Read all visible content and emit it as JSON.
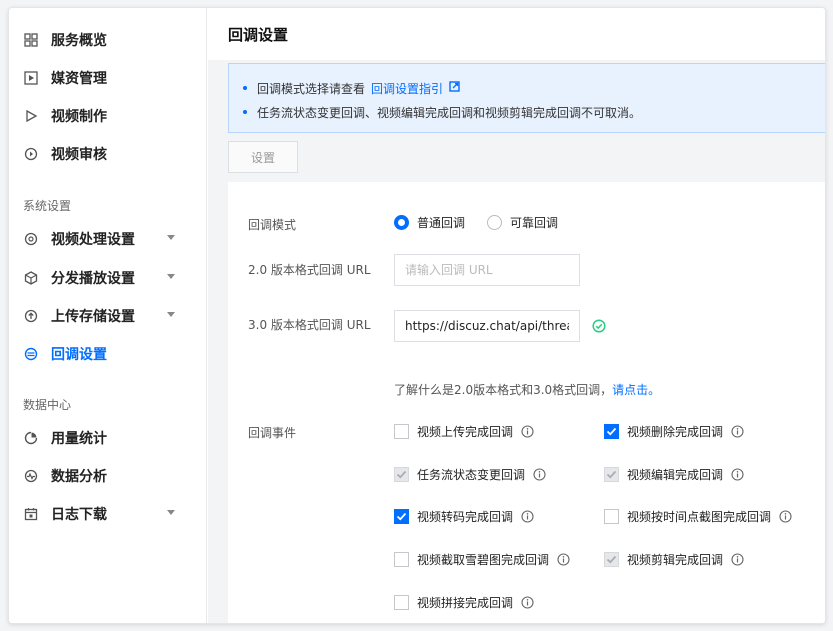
{
  "sidebar": {
    "items": [
      {
        "label": "服务概览",
        "icon": "grid-icon"
      },
      {
        "label": "媒资管理",
        "icon": "media-icon"
      },
      {
        "label": "视频制作",
        "icon": "play-icon"
      },
      {
        "label": "视频审核",
        "icon": "review-icon"
      }
    ],
    "section_system": "系统设置",
    "system_items": [
      {
        "label": "视频处理设置",
        "icon": "process-icon"
      },
      {
        "label": "分发播放设置",
        "icon": "cube-icon"
      },
      {
        "label": "上传存储设置",
        "icon": "upload-icon"
      },
      {
        "label": "回调设置",
        "icon": "callback-icon"
      }
    ],
    "section_data": "数据中心",
    "data_items": [
      {
        "label": "用量统计",
        "icon": "pie-icon"
      },
      {
        "label": "数据分析",
        "icon": "pulse-icon"
      },
      {
        "label": "日志下载",
        "icon": "calendar-icon"
      }
    ]
  },
  "page": {
    "title": "回调设置"
  },
  "notice": {
    "line1": "回调模式选择请查看",
    "line1_link": "回调设置指引",
    "line2": "任务流状态变更回调、视频编辑完成回调和视频剪辑完成回调不可取消。"
  },
  "settings_button": "设置",
  "form": {
    "mode_label": "回调模式",
    "mode_normal": "普通回调",
    "mode_reliable": "可靠回调",
    "v2_label": "2.0 版本格式回调 URL",
    "v2_placeholder": "请输入回调 URL",
    "v3_label": "3.0 版本格式回调 URL",
    "v3_value": "https://discuz.chat/api/threa",
    "hint": "了解什么是2.0版本格式和3.0格式回调，",
    "hint_link": "请点击。",
    "events_label": "回调事件",
    "events": [
      {
        "label": "视频上传完成回调",
        "state": "unchecked"
      },
      {
        "label": "视频删除完成回调",
        "state": "checked"
      },
      {
        "label": "任务流状态变更回调",
        "state": "disabled"
      },
      {
        "label": "视频编辑完成回调",
        "state": "disabled"
      },
      {
        "label": "视频转码完成回调",
        "state": "checked"
      },
      {
        "label": "视频按时间点截图完成回调",
        "state": "unchecked"
      },
      {
        "label": "视频截取雪碧图完成回调",
        "state": "unchecked"
      },
      {
        "label": "视频剪辑完成回调",
        "state": "disabled"
      },
      {
        "label": "视频拼接完成回调",
        "state": "unchecked"
      }
    ]
  },
  "colors": {
    "accent": "#006eff",
    "success": "#29cc85",
    "notice_bg": "#e8f1fe"
  }
}
